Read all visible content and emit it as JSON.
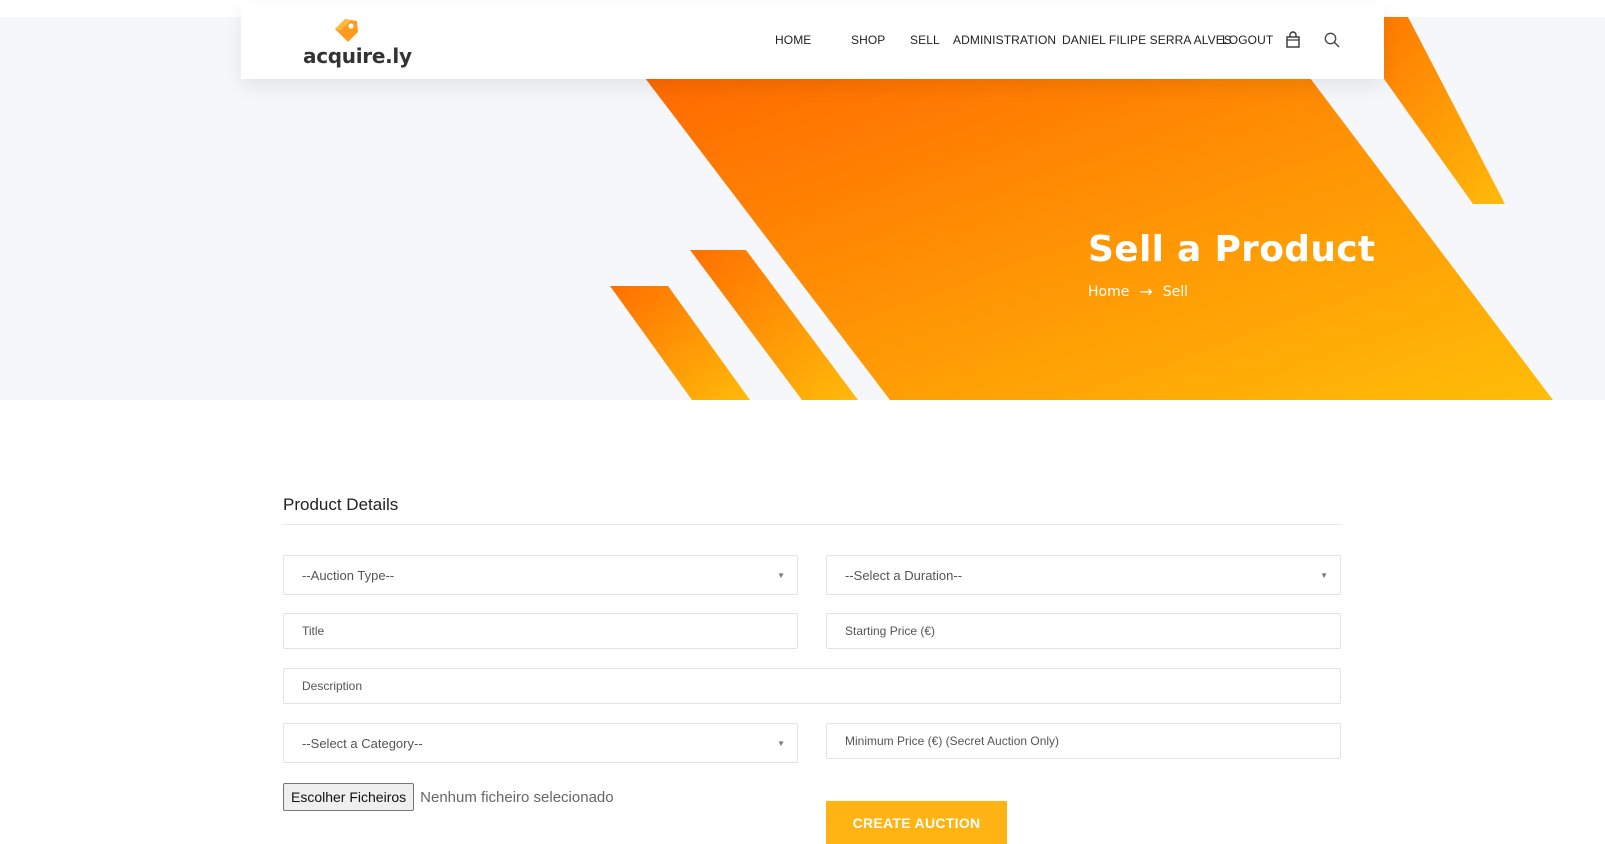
{
  "brand": {
    "name": "acquire.ly"
  },
  "nav": {
    "links": [
      "HOME",
      "SHOP",
      "SELL",
      "ADMINISTRATION",
      "DANIEL FILIPE SERRA ALVES",
      "LOGOUT"
    ],
    "icons": [
      "cart-icon",
      "search-icon"
    ]
  },
  "hero": {
    "title": "Sell a Product",
    "breadcrumb": {
      "home": "Home",
      "separator": "→",
      "current": "Sell"
    }
  },
  "form": {
    "section_title": "Product Details",
    "auction_type": "--Auction Type--",
    "duration": "--Select a Duration--",
    "title_placeholder": "Title",
    "starting_price_placeholder": "Starting Price (€)",
    "description_placeholder": "Description",
    "category": "--Select a Category--",
    "minimum_price_placeholder": "Minimum Price (€) (Secret Auction Only)",
    "file_button": "Escolher Ficheiros",
    "file_status": "Nenhum ficheiro selecionado",
    "submit": "CREATE AUCTION"
  },
  "colors": {
    "accent_orange": "#ff7a00",
    "accent_yellow": "#ffb413",
    "hero_bg": "#f6f7fb"
  }
}
